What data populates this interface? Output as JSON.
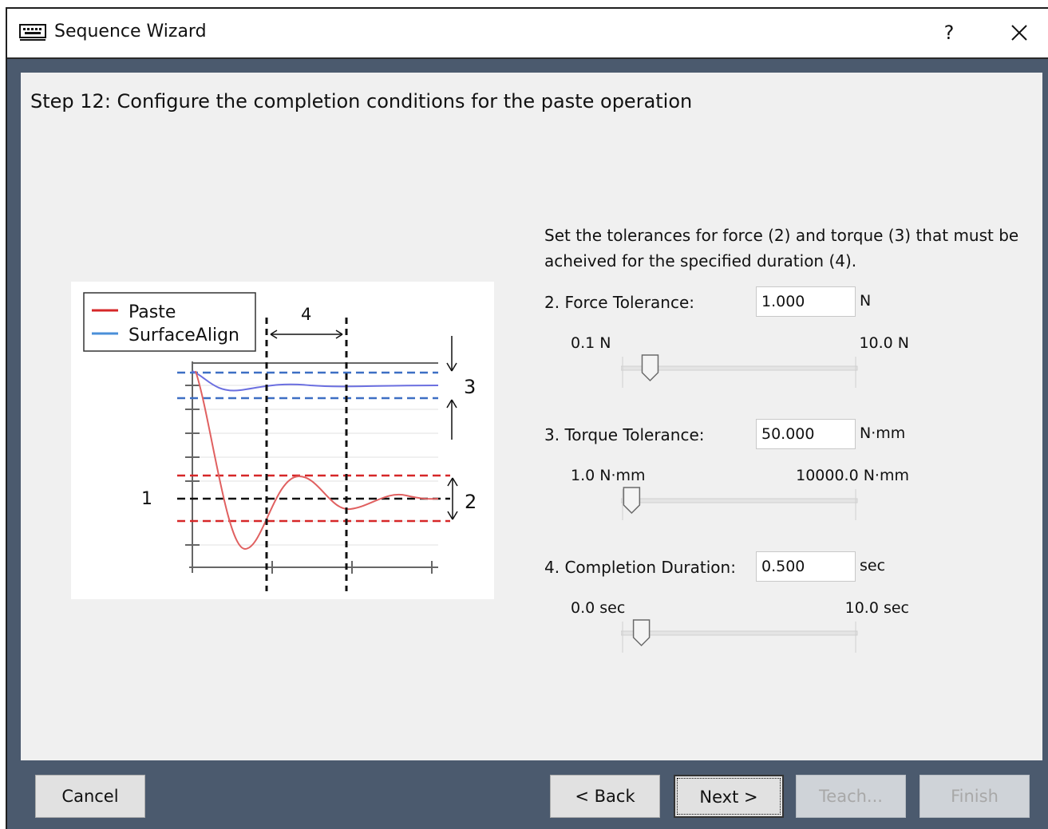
{
  "window": {
    "title": "Sequence Wizard",
    "help_label": "?",
    "close_icon": "close-icon",
    "app_icon": "keyboard-icon"
  },
  "step_title": "Step 12: Configure the completion conditions for the paste operation",
  "description": "Set the tolerances for force (2) and torque (3) that must be acheived for the specified duration (4).",
  "diagram": {
    "legend": [
      "Paste",
      "SurfaceAlign"
    ],
    "annotations": {
      "label_1": "1",
      "label_2": "2",
      "label_3": "3",
      "label_4": "4"
    },
    "colors": {
      "paste": "#d62728",
      "surface_align": "#4a6fd8",
      "band_paste": "#d62728",
      "band_surface": "#3d6fc4"
    }
  },
  "fields": {
    "force": {
      "label": "2. Force Tolerance:",
      "value": "1.000",
      "unit": "N",
      "min_label": "0.1 N",
      "max_label": "10.0 N",
      "slider_fraction": 0.09
    },
    "torque": {
      "label": "3. Torque Tolerance:",
      "value": "50.000",
      "unit": "N·mm",
      "min_label": "1.0 N·mm",
      "max_label": "10000.0 N·mm",
      "slider_fraction": 0.005
    },
    "duration": {
      "label": "4. Completion Duration:",
      "value": "0.500",
      "unit": "sec",
      "min_label": "0.0 sec",
      "max_label": "10.0 sec",
      "slider_fraction": 0.05
    }
  },
  "buttons": {
    "cancel": "Cancel",
    "back": "< Back",
    "next": "Next >",
    "teach": "Teach...",
    "finish": "Finish"
  }
}
